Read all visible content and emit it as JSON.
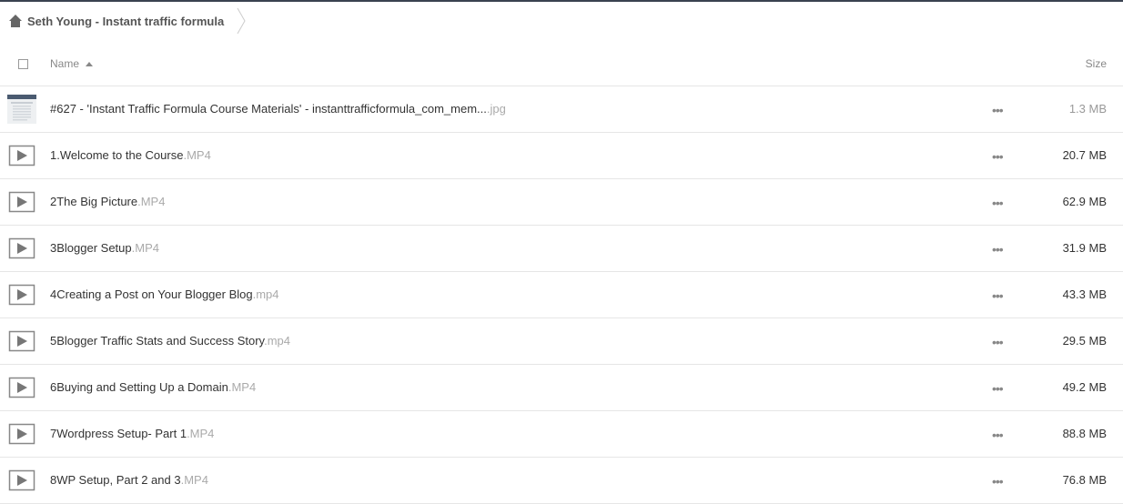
{
  "breadcrumb": {
    "folder": "Seth Young - Instant traffic formula"
  },
  "header": {
    "name_label": "Name",
    "size_label": "Size"
  },
  "files": [
    {
      "name": "#627 - 'Instant Traffic Formula Course Materials' - instanttrafficformula_com_mem...",
      "ext": ".jpg",
      "size": "1.3 MB",
      "icon": "image-thumbnail"
    },
    {
      "name": "1.Welcome to the Course",
      "ext": ".MP4",
      "size": "20.7 MB",
      "icon": "video-play-icon"
    },
    {
      "name": "2The Big Picture",
      "ext": ".MP4",
      "size": "62.9 MB",
      "icon": "video-play-icon"
    },
    {
      "name": "3Blogger Setup",
      "ext": ".MP4",
      "size": "31.9 MB",
      "icon": "video-play-icon"
    },
    {
      "name": "4Creating a Post on Your Blogger Blog",
      "ext": ".mp4",
      "size": "43.3 MB",
      "icon": "video-play-icon"
    },
    {
      "name": "5Blogger Traffic Stats and Success Story",
      "ext": ".mp4",
      "size": "29.5 MB",
      "icon": "video-play-icon"
    },
    {
      "name": "6Buying and Setting Up a Domain",
      "ext": ".MP4",
      "size": "49.2 MB",
      "icon": "video-play-icon"
    },
    {
      "name": "7Wordpress Setup- Part 1",
      "ext": ".MP4",
      "size": "88.8 MB",
      "icon": "video-play-icon"
    },
    {
      "name": "8WP Setup, Part 2 and 3",
      "ext": ".MP4",
      "size": "76.8 MB",
      "icon": "video-play-icon"
    }
  ],
  "more_label": "•••"
}
